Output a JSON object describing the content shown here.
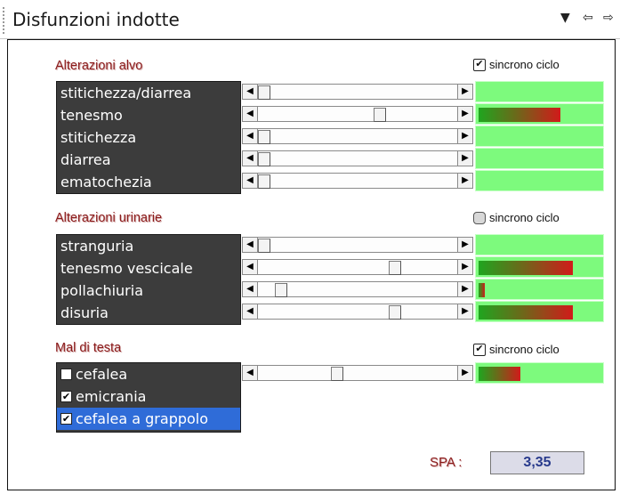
{
  "window": {
    "title": "Disfunzioni indotte"
  },
  "titlebar_icons": {
    "dropdown": "▼",
    "prev": "⇦",
    "next": "⇨"
  },
  "sections": {
    "alvo": {
      "title": "Alterazioni alvo",
      "sync_label": "sincrono ciclo",
      "sync_checked": true,
      "items": [
        {
          "label": "stitichezza/diarrea",
          "slider_level": 0.0,
          "meter_level": 0.0
        },
        {
          "label": "tenesmo",
          "slider_level": 0.62,
          "meter_level": 0.66
        },
        {
          "label": "stitichezza",
          "slider_level": 0.0,
          "meter_level": 0.0
        },
        {
          "label": "diarrea",
          "slider_level": 0.0,
          "meter_level": 0.0
        },
        {
          "label": "ematochezia",
          "slider_level": 0.0,
          "meter_level": 0.0
        }
      ]
    },
    "urinarie": {
      "title": "Alterazioni urinarie",
      "sync_label": "sincrono ciclo",
      "sync_checked": false,
      "items": [
        {
          "label": "stranguria",
          "slider_level": 0.0,
          "meter_level": 0.0
        },
        {
          "label": "tenesmo vescicale",
          "slider_level": 0.7,
          "meter_level": 0.76
        },
        {
          "label": "pollachiuria",
          "slider_level": 0.09,
          "meter_level": 0.05
        },
        {
          "label": "disuria",
          "slider_level": 0.7,
          "meter_level": 0.76
        }
      ]
    },
    "testa": {
      "title": "Mal di testa",
      "sync_label": "sincrono ciclo",
      "sync_checked": true,
      "items": [
        {
          "label": "cefalea",
          "checked": false,
          "selected": false
        },
        {
          "label": "emicrania",
          "checked": true,
          "selected": false
        },
        {
          "label": "cefalea a grappolo",
          "checked": true,
          "selected": true
        }
      ],
      "slider_level": 0.39,
      "meter_level": 0.34
    }
  },
  "spa": {
    "label": "SPA :",
    "value": "3,35"
  },
  "colors": {
    "meter_bg": "#7dfa7d",
    "list_bg": "#3c3c3c",
    "section_title": "#8a1a1a",
    "spa_value": "#283a8c",
    "selected_row": "#2f6cd8"
  }
}
